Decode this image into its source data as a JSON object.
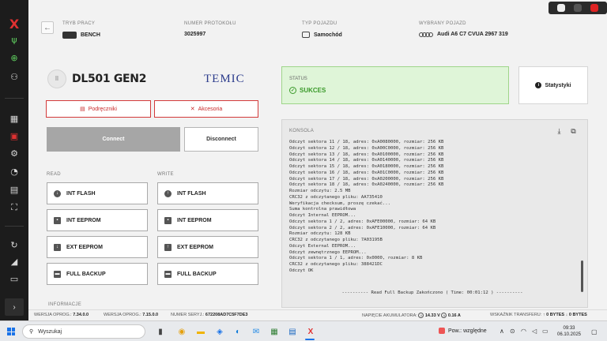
{
  "sidebar": {
    "items": [
      {
        "icon": "usb-icon",
        "glyph": "ψ",
        "color": "#5fcf5f"
      },
      {
        "icon": "globe-icon",
        "glyph": "⊕",
        "color": "#5fcf5f"
      },
      {
        "icon": "network-icon",
        "glyph": "⚇",
        "color": "#d8d8d8"
      },
      {
        "icon": "dashboard-icon",
        "glyph": "▦",
        "color": "#d8d8d8"
      },
      {
        "icon": "chip-icon",
        "glyph": "▣",
        "color": "#e03131"
      },
      {
        "icon": "gear-icon",
        "glyph": "⚙",
        "color": "#d8d8d8"
      },
      {
        "icon": "gauge-icon",
        "glyph": "◔",
        "color": "#d8d8d8"
      },
      {
        "icon": "document-icon",
        "glyph": "▤",
        "color": "#d8d8d8"
      },
      {
        "icon": "expand-icon",
        "glyph": "⛶",
        "color": "#d8d8d8"
      },
      {
        "icon": "refresh-icon",
        "glyph": "↻",
        "color": "#d8d8d8"
      },
      {
        "icon": "chart-icon",
        "glyph": "◢",
        "color": "#d8d8d8"
      },
      {
        "icon": "terminal-icon",
        "glyph": "▭",
        "color": "#d8d8d8"
      }
    ],
    "expand_glyph": "›"
  },
  "header": {
    "work_mode_label": "TRYB PRACY",
    "work_mode_value": "BENCH",
    "protocol_label": "NUMER PROTOKOŁU",
    "protocol_value": "3025997",
    "vehicle_type_label": "TYP POJAZDU",
    "vehicle_type_value": "Samochód",
    "selected_vehicle_label": "WYBRANY POJAZD",
    "selected_vehicle_value": "Audi A6 C7 CVUA 2967 319"
  },
  "device": {
    "title": "DL501 GEN2",
    "brand": "TEMIC",
    "manuals_label": "Podręczniki",
    "accessories_label": "Akcesoria",
    "connect_label": "Connect",
    "disconnect_label": "Disconnect"
  },
  "read": {
    "label": "READ",
    "buttons": [
      "INT FLASH",
      "INT EEPROM",
      "EXT EEPROM",
      "FULL BACKUP"
    ]
  },
  "write": {
    "label": "WRITE",
    "buttons": [
      "INT FLASH",
      "INT EEPROM",
      "EXT EEPROM",
      "FULL BACKUP"
    ]
  },
  "info_label": "INFORMACJE",
  "status": {
    "label": "STATUS",
    "value": "SUKCES",
    "color": "#3a9a2a"
  },
  "stats_label": "Statystyki",
  "console": {
    "title": "KONSOLA",
    "lines": [
      "Odczyt sektora 11 / 18, adres: 0xA0080000, rozmiar: 256 KB",
      "Odczyt sektora 12 / 18, adres: 0xA00C0000, rozmiar: 256 KB",
      "Odczyt sektora 13 / 18, adres: 0xA0100000, rozmiar: 256 KB",
      "Odczyt sektora 14 / 18, adres: 0xA0140000, rozmiar: 256 KB",
      "Odczyt sektora 15 / 18, adres: 0xA0180000, rozmiar: 256 KB",
      "Odczyt sektora 16 / 18, adres: 0xA01C0000, rozmiar: 256 KB",
      "Odczyt sektora 17 / 18, adres: 0xA0200000, rozmiar: 256 KB",
      "Odczyt sektora 18 / 18, adres: 0xA0240000, rozmiar: 256 KB",
      "Rozmiar odczytu: 2.5 MB",
      "CRC32 z odczytanego pliku: AA735410",
      "Weryfikacja checksum, proszę czekać...",
      "Suma kontrolna prawidłowa",
      "Odczyt Internal EEPROM...",
      "Odczyt sektora 1 / 2, adres: 0xAFE00000, rozmiar: 64 KB",
      "Odczyt sektora 2 / 2, adres: 0xAFE10000, rozmiar: 64 KB",
      "Rozmiar odczytu: 128 KB",
      "CRC32 z odczytanego pliku: 7A03195B",
      "Odczyt External EEPROM...",
      "Odczyt zewnętrznego EEPROM...",
      "Odczyt sektora 1 / 1, adres: 0x0000, rozmiar: 8 KB",
      "CRC32 z odczytanego pliku: 388421DC",
      "Odczyt OK"
    ],
    "footer": "---------- Read Full Backup Zakończono ( Time: 00:01:12 ) ----------"
  },
  "statusbar": {
    "software_version_label": "WERSJA OPROG.:",
    "software_version": "7.34.0.0",
    "firmware_version_label": "WERSJA OPROG.:",
    "firmware_version": "7.15.0.0",
    "serial_label": "NUMER SERYJ.:",
    "serial": "672208AD7C5F7DE3",
    "battery_label": "NAPIĘCIE AKUMULATORA:",
    "voltage": "14.33 V",
    "current": "0.16 A",
    "transfer_label": "WSKAŹNIK TRANSFERU:",
    "transfer_up": "0 BYTES",
    "transfer_down": "0 BYTES"
  },
  "taskbar": {
    "search_placeholder": "Wyszukaj",
    "weather_text": "Pow.: względne",
    "time": "09:33",
    "date": "06.10.2025"
  },
  "colors": {
    "accent_red": "#d33a3a",
    "sidebar_bg": "#1c1c1c",
    "success_bg": "#dff5d8"
  }
}
